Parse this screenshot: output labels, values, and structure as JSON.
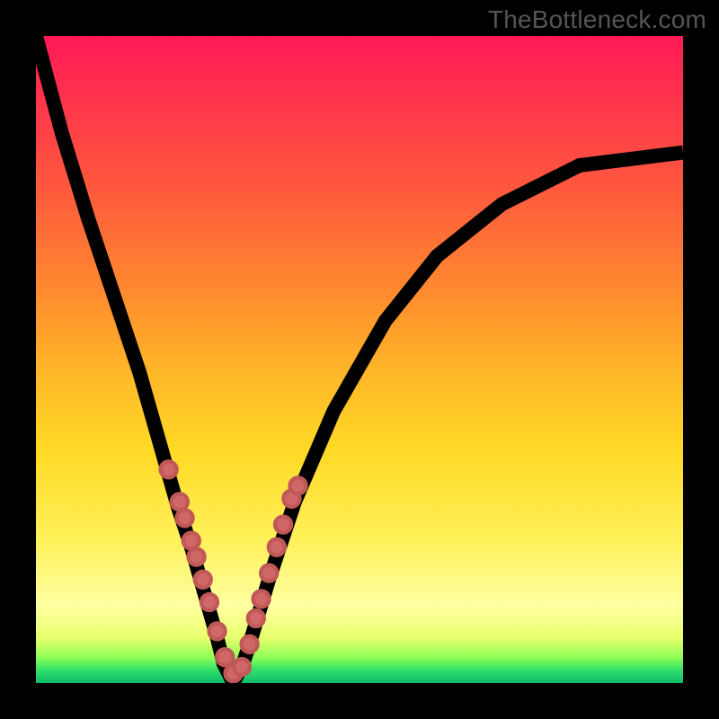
{
  "watermark": "TheBottleneck.com",
  "chart_data": {
    "type": "line",
    "title": "",
    "xlabel": "",
    "ylabel": "",
    "xlim": [
      0,
      100
    ],
    "ylim": [
      0,
      100
    ],
    "grid": false,
    "legend": false,
    "series": [
      {
        "name": "bottleneck-curve",
        "type": "line",
        "color": "#000000",
        "x": [
          0,
          4,
          8,
          12,
          16,
          20,
          22,
          24,
          26,
          28,
          29,
          30,
          31,
          32,
          33,
          36,
          40,
          46,
          54,
          62,
          72,
          84,
          100
        ],
        "y": [
          100,
          85,
          72,
          60,
          48,
          34,
          27,
          21,
          14,
          7,
          3,
          1,
          1,
          3,
          6,
          16,
          28,
          42,
          56,
          66,
          74,
          80,
          82
        ]
      },
      {
        "name": "highlight-points",
        "type": "scatter",
        "color": "#d16868",
        "x": [
          20.5,
          22.2,
          23.0,
          24.0,
          24.8,
          25.8,
          26.8,
          28.0,
          29.2,
          30.5,
          31.8,
          33.0,
          34.0,
          34.8,
          36.0,
          37.2,
          38.2,
          39.5,
          40.5
        ],
        "y": [
          33,
          28,
          25.5,
          22,
          19.5,
          16,
          12.5,
          8,
          4,
          1.5,
          2.5,
          6,
          10,
          13,
          17,
          21,
          24.5,
          28.5,
          30.5
        ]
      }
    ],
    "background_gradient_stops": [
      {
        "pos": 0.0,
        "color": "#ff1955"
      },
      {
        "pos": 0.24,
        "color": "#ff5a3d"
      },
      {
        "pos": 0.52,
        "color": "#ffb728"
      },
      {
        "pos": 0.78,
        "color": "#fff15a"
      },
      {
        "pos": 0.93,
        "color": "#e8ff6d"
      },
      {
        "pos": 1.0,
        "color": "#0dbb6a"
      }
    ]
  }
}
